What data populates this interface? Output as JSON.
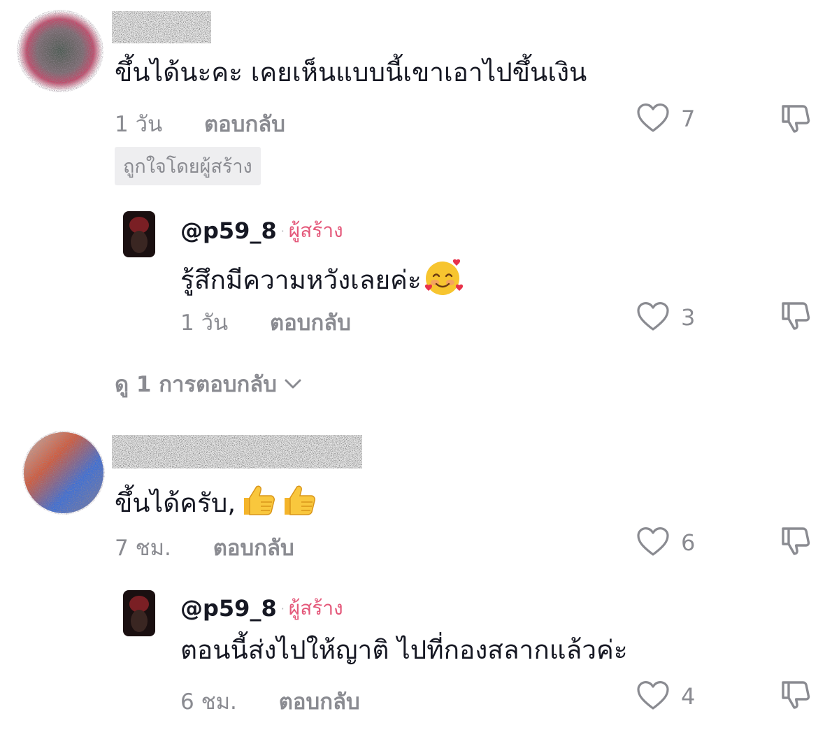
{
  "comments": [
    {
      "text": "ขึ้นได้นะคะ เคยเห็นแบบนี้เขาเอาไปขึ้นเงิน",
      "time": "1 วัน",
      "reply_label": "ตอบกลับ",
      "likes": "7",
      "badge": "ถูกใจโดยผู้สร้าง",
      "reply": {
        "handle": "@p59_8",
        "separator": "·",
        "creator_label": "ผู้สร้าง",
        "text": "รู้สึกมีความหวังเลยค่ะ",
        "emoji": "smiling-face-with-hearts",
        "time": "1 วัน",
        "reply_label": "ตอบกลับ",
        "likes": "3"
      },
      "view_replies": "ดู 1 การตอบกลับ"
    },
    {
      "text": "ขึ้นได้ครับ,",
      "emoji": [
        "thumbs-up",
        "thumbs-up"
      ],
      "time": "7 ชม.",
      "reply_label": "ตอบกลับ",
      "likes": "6",
      "reply": {
        "handle": "@p59_8",
        "separator": "·",
        "creator_label": "ผู้สร้าง",
        "text": "ตอนนี้ส่งไปให้ญาติ ไปที่กองสลากแล้วค่ะ",
        "time": "6 ชม.",
        "reply_label": "ตอบกลับ",
        "likes": "4"
      }
    }
  ],
  "icons": {
    "like": "heart-outline-icon",
    "dislike": "thumbs-down-outline-icon",
    "expand": "chevron-down-icon"
  },
  "colors": {
    "text": "#161823",
    "muted": "#8a8b91",
    "creator": "#e4587a",
    "badge_bg": "#eeeef0"
  }
}
